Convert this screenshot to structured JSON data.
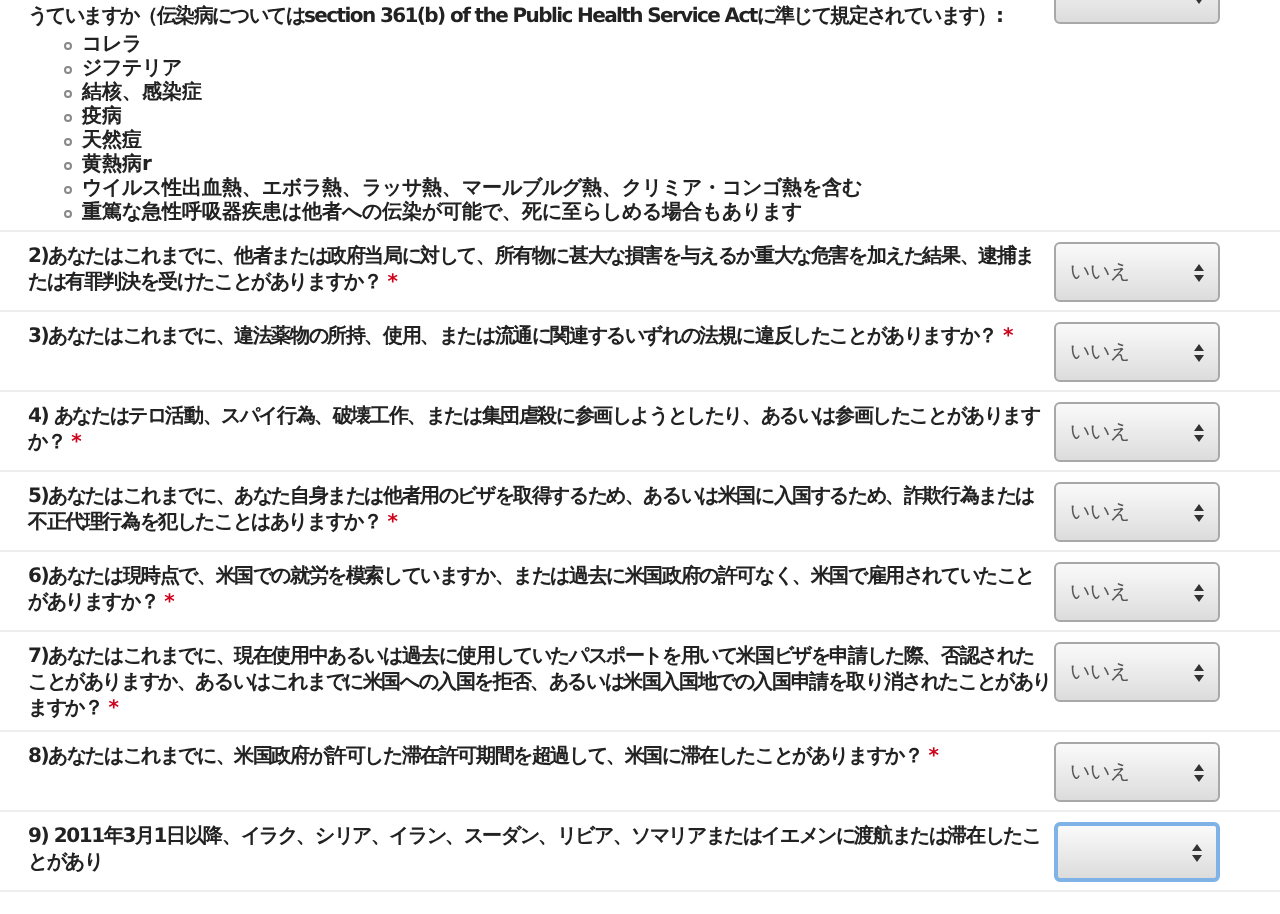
{
  "intro": {
    "text": "うていますか（伝染病についてはsection 361(b) of the Public Health Service Actに準じて規定されています）:",
    "diseases": [
      "コレラ",
      "ジフテリア",
      "結核、感染症",
      "疫病",
      "天然痘",
      "黄熱病r",
      "ウイルス性出血熱、エボラ熱、ラッサ熱、マールブルグ熱、クリミア・コンゴ熱を含む",
      "重篤な急性呼吸器疾患は他者への伝染が可能で、死に至らしめる場合もあります"
    ]
  },
  "questions": [
    {
      "text": "2)あなたはこれまでに、他者または政府当局に対して、所有物に甚大な損害を与えるか重大な危害を加えた結果、逮捕または有罪判決を受けたことがありますか？",
      "required_mark": "*",
      "answer": "いいえ",
      "focused": false
    },
    {
      "text": "3)あなたはこれまでに、違法薬物の所持、使用、または流通に関連するいずれの法規に違反したことがありますか？",
      "required_mark": "*",
      "answer": "いいえ",
      "focused": false
    },
    {
      "text": "4) あなたはテロ活動、スパイ行為、破壊工作、または集団虐殺に参画しようとしたり、あるいは参画したことがありますか？",
      "required_mark": "*",
      "answer": "いいえ",
      "focused": false
    },
    {
      "text": "5)あなたはこれまでに、あなた自身または他者用のビザを取得するため、あるいは米国に入国するため、詐欺行為または不正代理行為を犯したことはありますか？",
      "required_mark": "*",
      "answer": "いいえ",
      "focused": false
    },
    {
      "text": "6)あなたは現時点で、米国での就労を模索していますか、または過去に米国政府の許可なく、米国で雇用されていたことがありますか？",
      "required_mark": "*",
      "answer": "いいえ",
      "focused": false
    },
    {
      "text": "7)あなたはこれまでに、現在使用中あるいは過去に使用していたパスポートを用いて米国ビザを申請した際、否認されたことがありますか、あるいはこれまでに米国への入国を拒否、あるいは米国入国地での入国申請を取り消されたことがありますか？",
      "required_mark": "*",
      "answer": "いいえ",
      "focused": false
    },
    {
      "text": "8)あなたはこれまでに、米国政府が許可した滞在許可期間を超過して、米国に滞在したことがありますか？",
      "required_mark": "*",
      "answer": "いいえ",
      "focused": false
    },
    {
      "text": "9) 2011年3月1日以降、イラク、シリア、イラン、スーダン、リビア、ソマリアまたはイエメンに渡航または滞在したことがあり",
      "focused": true
    }
  ]
}
